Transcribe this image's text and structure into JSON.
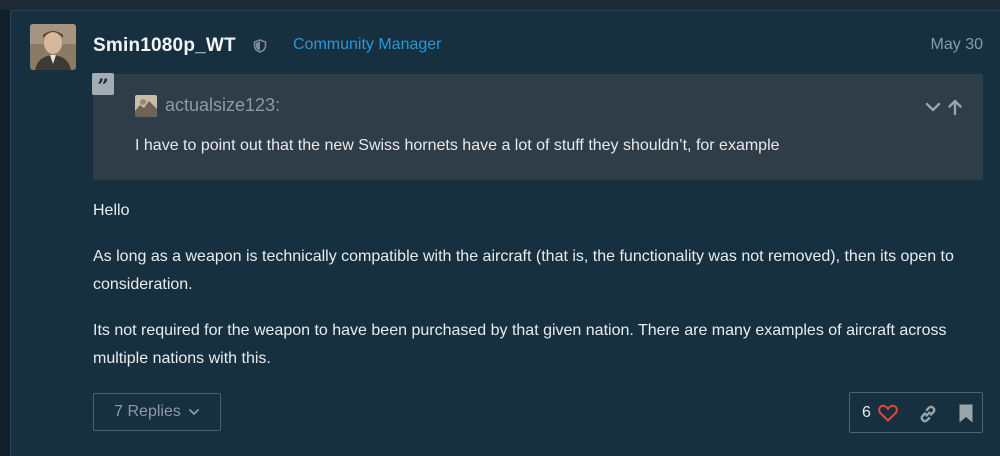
{
  "post": {
    "username": "Smin1080p_WT",
    "role": "Community Manager",
    "date": "May 30",
    "quote": {
      "user": "actualsize123:",
      "text": "I have to point out that the new Swiss hornets have a lot of stuff they shouldn’t, for example"
    },
    "paragraphs": [
      "Hello",
      "As long as a weapon is technically compatible with the aircraft (that is, the functionality was not removed), then its open to consideration.",
      "Its not required for the weapon to have been purchased by that given nation. There are many examples of aircraft across multiple nations with this."
    ],
    "replies_label": "7 Replies",
    "like_count": "6"
  },
  "colors": {
    "background": "#16303f",
    "role": "#2c97d8",
    "heart": "#e0463d",
    "quote_bg": "#2e3d48"
  },
  "icons": [
    "shield-icon",
    "quote-icon",
    "chevron-down-icon",
    "arrow-up-icon",
    "heart-icon",
    "link-icon",
    "bookmark-icon"
  ]
}
